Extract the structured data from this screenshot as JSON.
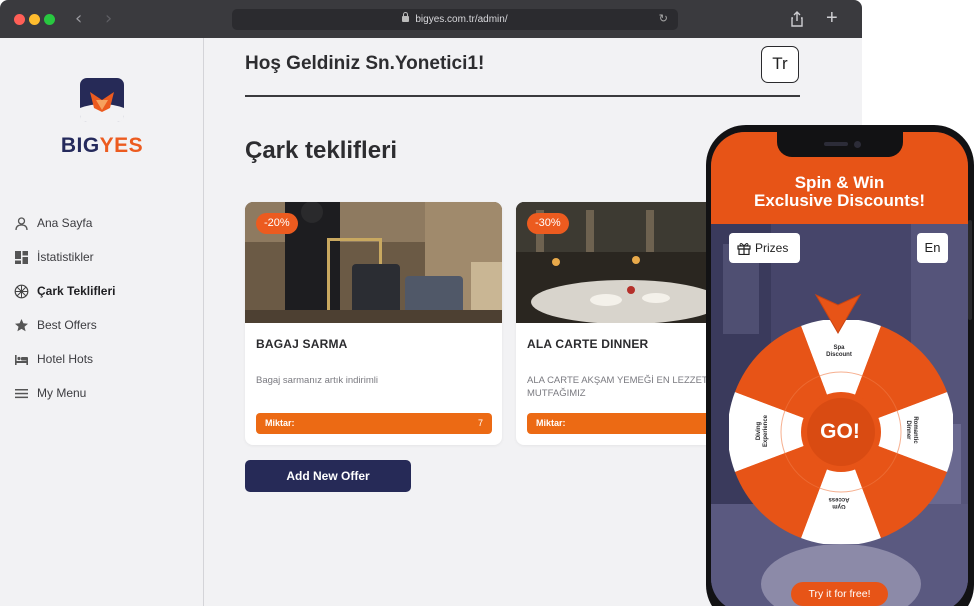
{
  "browser": {
    "url": "bigyes.com.tr/admin/"
  },
  "sidebar": {
    "brand": {
      "part1": "BIG",
      "part2": "YES"
    },
    "items": [
      {
        "label": "Ana Sayfa",
        "icon": "user-icon",
        "active": false
      },
      {
        "label": "İstatistikler",
        "icon": "dashboard-icon",
        "active": false
      },
      {
        "label": "Çark Teklifleri",
        "icon": "wheel-icon",
        "active": true
      },
      {
        "label": "Best Offers",
        "icon": "star-icon",
        "active": false
      },
      {
        "label": "Hotel Hots",
        "icon": "bed-icon",
        "active": false
      },
      {
        "label": "My Menu",
        "icon": "menu-icon",
        "active": false
      }
    ]
  },
  "header": {
    "welcome": "Hoş Geldiniz Sn.Yonetici1!",
    "language": "Tr"
  },
  "page": {
    "title": "Çark teklifleri",
    "add_button": "Add New Offer"
  },
  "offers": [
    {
      "discount": "-20%",
      "title": "BAGAJ SARMA",
      "description": "Bagaj sarmanız artık indirimli",
      "amount_label": "Miktar:",
      "amount_value": "7"
    },
    {
      "discount": "-30%",
      "title": "ALA CARTE DINNER",
      "description": "ALA CARTE AKŞAM YEMEĞİ EN LEZZETLİ MUTFAĞIMIZ",
      "amount_label": "Miktar:",
      "amount_value": ""
    }
  ],
  "phone": {
    "headline_line1": "Spin & Win",
    "headline_line2": "Exclusive Discounts!",
    "prizes_label": "Prizes",
    "language": "En",
    "go_label": "GO!",
    "segments": {
      "spa": [
        "Spa",
        "Discount"
      ],
      "romantic": [
        "Romantic",
        "Dinner"
      ],
      "gym": [
        "Gym",
        "Access"
      ],
      "diving": [
        "Diving",
        "Experience"
      ]
    },
    "cta": "Try it for free!"
  },
  "colors": {
    "accent": "#ec5b1f",
    "navy": "#262a57",
    "sidebar_bg": "#f2f2f4"
  }
}
